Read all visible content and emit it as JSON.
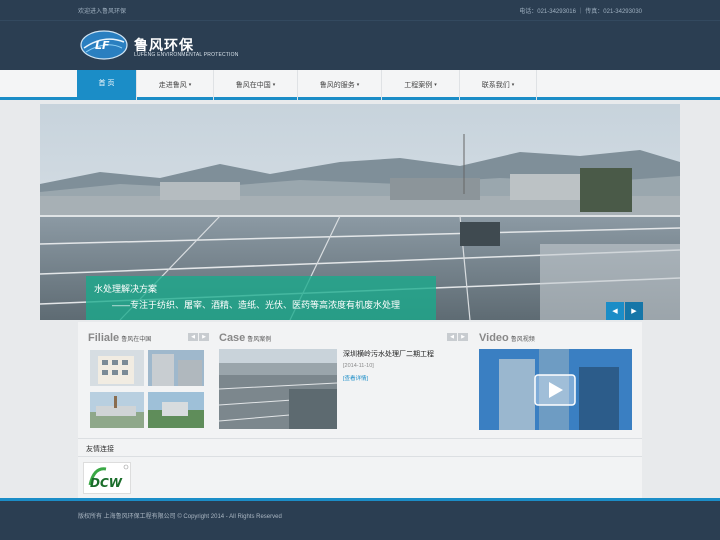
{
  "topbar": {
    "welcome": "欢迎进入鲁风环保",
    "contact": "电话：021-34293016 ｜ 传真：021-34293030"
  },
  "header": {
    "brand": "鲁风环保",
    "brand_en": "LUFENG ENVIRONMENTAL PROTECTION",
    "logo_text": "LF"
  },
  "nav": {
    "items": [
      {
        "label": "首 页",
        "active": true
      },
      {
        "label": "走进鲁风",
        "caret": "▾"
      },
      {
        "label": "鲁风在中国",
        "caret": "▾"
      },
      {
        "label": "鲁风的服务",
        "caret": "▾"
      },
      {
        "label": "工程案例",
        "caret": "▾"
      },
      {
        "label": "联系我们",
        "caret": "▾"
      }
    ]
  },
  "banner": {
    "caption_title": "水处理解决方案",
    "caption_sub": "——专注于纺织、屠宰、酒精、造纸、光伏、医药等高浓度有机废水处理",
    "prev": "◀",
    "next": "▶"
  },
  "sections": {
    "filiale": {
      "title": "Filiale",
      "sub": "鲁风在中国",
      "btn_prev": "◀",
      "btn_next": "▶"
    },
    "case": {
      "title": "Case",
      "sub": "鲁风案例",
      "btn_prev": "◀",
      "btn_next": "▶",
      "item_title": "深圳横岭污水处理厂二期工程",
      "item_date": "[2014-11-10]",
      "item_more": "[查看详情]"
    },
    "video": {
      "title": "Video",
      "sub": "鲁风视频"
    }
  },
  "links": {
    "title": "友情连接",
    "partner_logo_text": "DCW"
  },
  "footer": {
    "copyright": "版权所有 上海鲁风环保工程有限公司 © Copyright 2014 - All Rights Reserved"
  },
  "colors": {
    "header_bg": "#2b3e52",
    "accent": "#1b8dc7",
    "caption_bg": "#18aa8c"
  }
}
